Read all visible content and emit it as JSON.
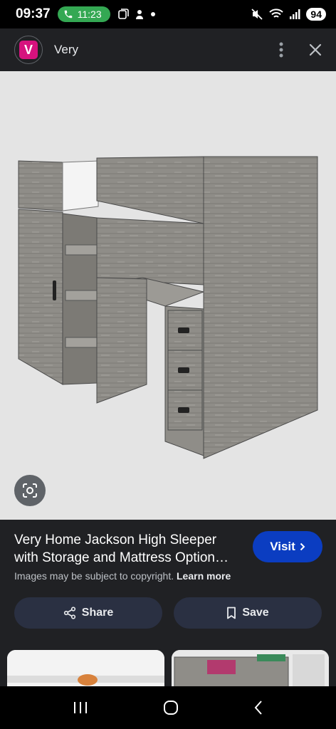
{
  "status_bar": {
    "time": "09:37",
    "call_duration": "11:23",
    "battery": "94"
  },
  "app_bar": {
    "site_logo_letter": "V",
    "site_name": "Very",
    "icons": [
      "more-vert-icon",
      "close-icon"
    ]
  },
  "product": {
    "title": "Very Home Jackson High Sleeper with Storage and Mattress Option…",
    "visit_label": "Visit",
    "copyright_text": "Images may be subject to copyright.",
    "learn_more": "Learn more"
  },
  "actions": {
    "share_label": "Share",
    "save_label": "Save"
  },
  "colors": {
    "accent": "#0b3dc1",
    "brand": "#d6127e",
    "background": "#202124",
    "image_bg": "#e4e4e4"
  }
}
